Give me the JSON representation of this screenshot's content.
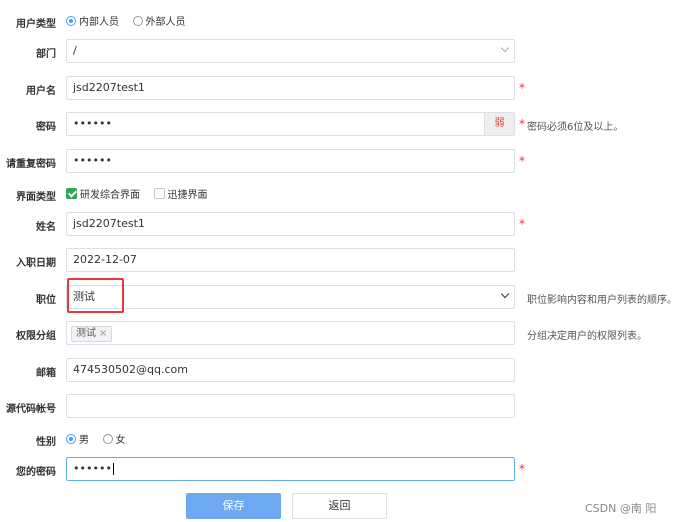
{
  "form": {
    "user_type": {
      "label": "用户类型",
      "options": [
        "内部人员",
        "外部人员"
      ],
      "selected": "内部人员"
    },
    "department": {
      "label": "部门",
      "value": "/"
    },
    "username": {
      "label": "用户名",
      "value": "jsd2207test1"
    },
    "password": {
      "label": "密码",
      "value": "••••••",
      "strength": "弱",
      "hint": "密码必须6位及以上。"
    },
    "confirm_password": {
      "label": "请重复密码",
      "value": "••••••"
    },
    "interface_type": {
      "label": "界面类型",
      "options": [
        "研发综合界面",
        "迅捷界面"
      ],
      "checked": [
        "研发综合界面"
      ]
    },
    "name": {
      "label": "姓名",
      "value": "jsd2207test1"
    },
    "hire_date": {
      "label": "入职日期",
      "value": "2022-12-07"
    },
    "position": {
      "label": "职位",
      "value": "测试",
      "hint": "职位影响内容和用户列表的顺序。"
    },
    "permission_group": {
      "label": "权限分组",
      "tag": "测试",
      "tag_remove": "×",
      "hint": "分组决定用户的权限列表。"
    },
    "email": {
      "label": "邮箱",
      "value": "474530502@qq.com"
    },
    "repo_account": {
      "label": "源代码帐号",
      "value": ""
    },
    "gender": {
      "label": "性别",
      "options": [
        "男",
        "女"
      ],
      "selected": "男"
    },
    "your_password": {
      "label": "您的密码",
      "value": "••••••"
    },
    "required_mark": "*"
  },
  "buttons": {
    "save": "保存",
    "back": "返回"
  },
  "watermark": "CSDN @南 阳",
  "colors": {
    "primary": "#6ea8f0",
    "required": "#e4393c",
    "highlight": "#e4393c",
    "checkbox": "#2ea84f"
  }
}
